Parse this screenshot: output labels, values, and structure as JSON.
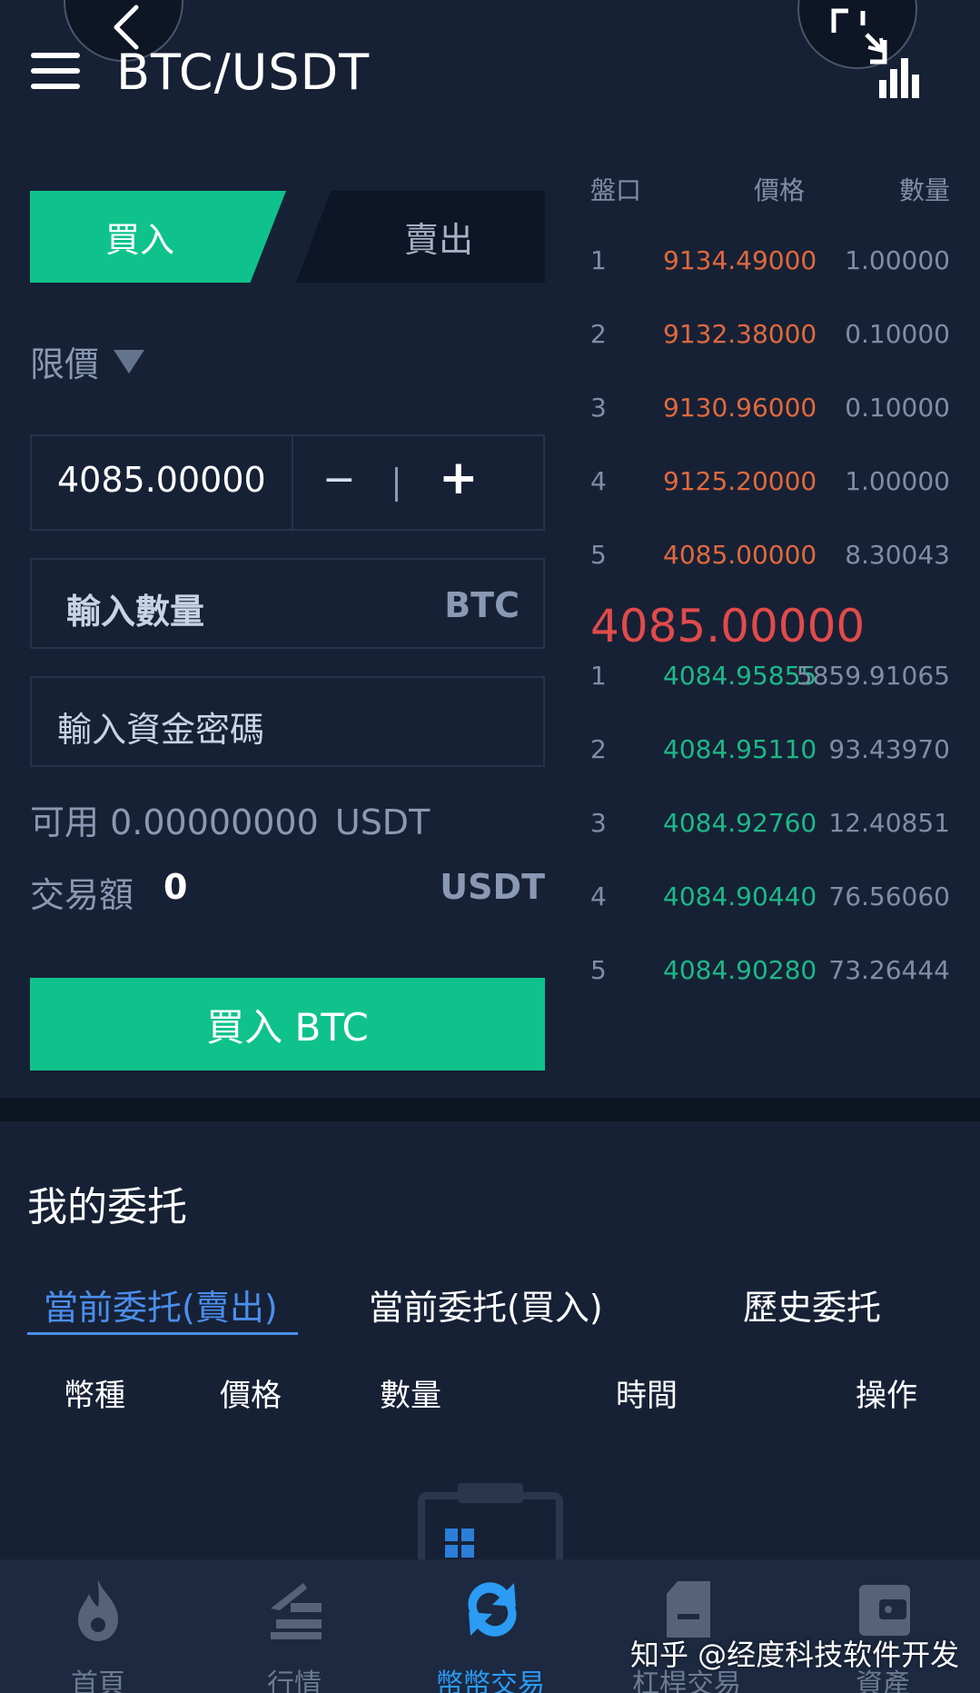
{
  "header": {
    "pair": "BTC/USDT"
  },
  "trade": {
    "tab_buy": "買入",
    "tab_sell": "賣出",
    "order_type": "限價",
    "price_value": "4085.00000",
    "minus": "−",
    "plus": "+",
    "amount_placeholder": "輸入數量",
    "amount_unit": "BTC",
    "password_placeholder": "輸入資金密碼",
    "available_label": "可用",
    "available_value": "0.00000000",
    "available_unit": "USDT",
    "trade_amount_label": "交易額",
    "trade_amount_value": "0",
    "trade_amount_unit": "USDT",
    "submit_label": "買入 BTC"
  },
  "orderbook": {
    "headers": {
      "level": "盤口",
      "price": "價格",
      "qty": "數量"
    },
    "asks": [
      {
        "idx": "1",
        "price": "9134.49000",
        "qty": "1.00000"
      },
      {
        "idx": "2",
        "price": "9132.38000",
        "qty": "0.10000"
      },
      {
        "idx": "3",
        "price": "9130.96000",
        "qty": "0.10000"
      },
      {
        "idx": "4",
        "price": "9125.20000",
        "qty": "1.00000"
      },
      {
        "idx": "5",
        "price": "4085.00000",
        "qty": "8.30043"
      }
    ],
    "last_price": "4085.00000",
    "bids": [
      {
        "idx": "1",
        "price": "4084.95855",
        "qty": "5859.91065"
      },
      {
        "idx": "2",
        "price": "4084.95110",
        "qty": "93.43970"
      },
      {
        "idx": "3",
        "price": "4084.92760",
        "qty": "12.40851"
      },
      {
        "idx": "4",
        "price": "4084.90440",
        "qty": "76.56060"
      },
      {
        "idx": "5",
        "price": "4084.90280",
        "qty": "73.26444"
      }
    ],
    "colors": {
      "ask": "#e0693e",
      "bid": "#1cb988",
      "last": "#e14b4b"
    }
  },
  "my_orders": {
    "title": "我的委托",
    "tabs": [
      "當前委托(賣出)",
      "當前委托(買入)",
      "歷史委托"
    ],
    "columns": [
      "幣種",
      "價格",
      "數量",
      "時間",
      "操作"
    ]
  },
  "nav": {
    "items": [
      {
        "label": "首頁",
        "icon": "fire-icon"
      },
      {
        "label": "行情",
        "icon": "market-icon"
      },
      {
        "label": "幣幣交易",
        "icon": "exchange-icon"
      },
      {
        "label": "杠桿交易",
        "icon": "document-icon"
      },
      {
        "label": "資產",
        "icon": "wallet-icon"
      }
    ],
    "active_color": "#2b9bf4"
  },
  "watermark": "知乎 @经度科技软件开发",
  "colors": {
    "background": "#172135",
    "buy_green": "#0fc28b",
    "accent_blue": "#4b8eec"
  }
}
